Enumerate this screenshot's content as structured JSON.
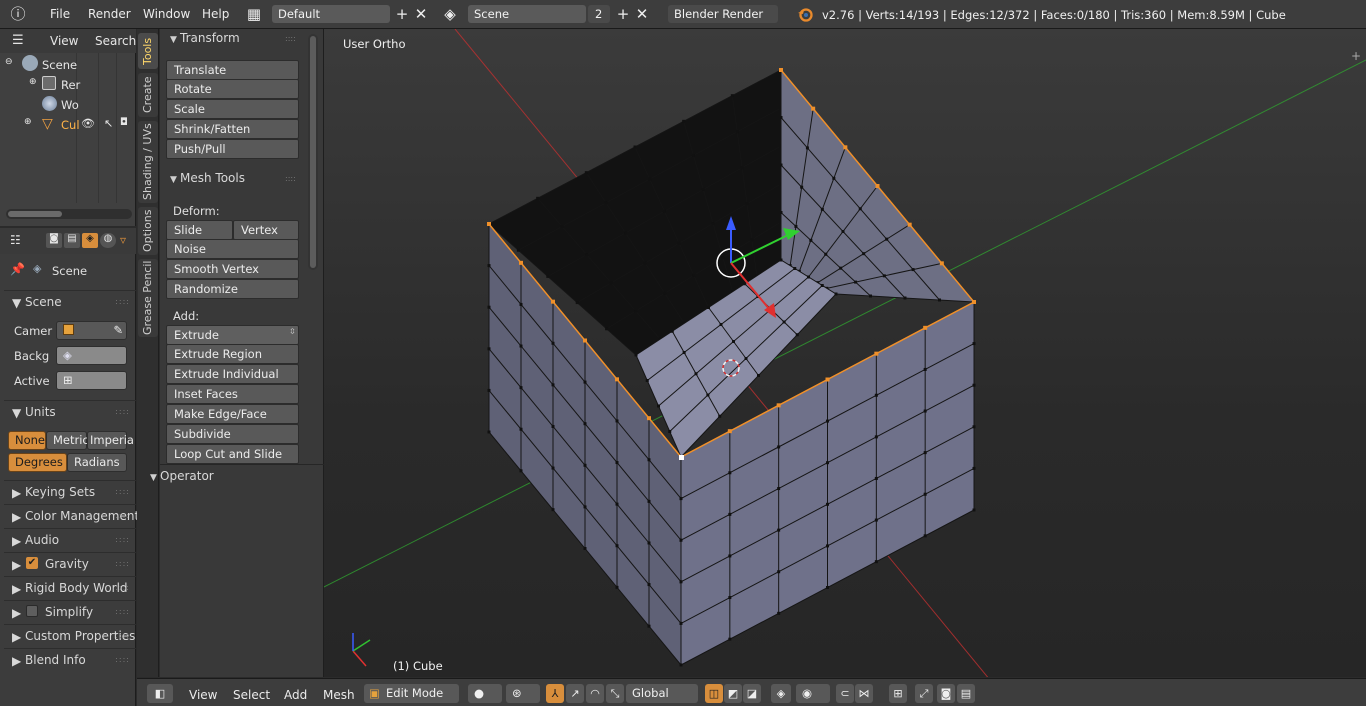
{
  "colors": {
    "accent": "#d88e3c",
    "axis_x": "#c03030",
    "axis_y": "#30a030",
    "select": "#f0902a"
  },
  "topbar": {
    "menus": [
      "File",
      "Render",
      "Window",
      "Help"
    ],
    "screen_layout": "Default",
    "scene_field": "Scene",
    "scene_users": "2",
    "render_engine": "Blender Render",
    "stats": "v2.76 | Verts:14/193 | Edges:12/372 | Faces:0/180 | Tris:360 | Mem:8.59M | Cube"
  },
  "outliner": {
    "header": {
      "view": "View",
      "search": "Search"
    },
    "items": [
      {
        "label": "Scene",
        "icon": "scene-icon"
      },
      {
        "label": "Rer",
        "icon": "render-layers-icon"
      },
      {
        "label": "Wo",
        "icon": "world-icon"
      },
      {
        "label": "Cul",
        "icon": "mesh-object-icon"
      }
    ]
  },
  "properties": {
    "context": "Scene",
    "sections": {
      "scene": "Scene",
      "camera_label": "Camer",
      "background_label": "Backg",
      "active_label": "Active",
      "units": "Units",
      "unit_none": "None",
      "unit_metric": "Metric",
      "unit_imperial": "Imperia",
      "deg": "Degrees",
      "rad": "Radians",
      "keying_sets": "Keying Sets",
      "color_management": "Color Management",
      "audio": "Audio",
      "gravity": "Gravity",
      "rigid_body": "Rigid Body World",
      "simplify": "Simplify",
      "custom_props": "Custom Properties",
      "blend_info": "Blend Info"
    }
  },
  "tooltabs": [
    "Tools",
    "Create",
    "Shading / UVs",
    "Options",
    "Grease Pencil"
  ],
  "toolshelf": {
    "transform": "Transform",
    "transform_buttons": [
      "Translate",
      "Rotate",
      "Scale",
      "Shrink/Fatten",
      "Push/Pull"
    ],
    "mesh_tools": "Mesh Tools",
    "deform": "Deform:",
    "slide_edge": "Slide Edge",
    "vertex": "Vertex",
    "deform_buttons": [
      "Noise",
      "Smooth Vertex",
      "Randomize"
    ],
    "add": "Add:",
    "extrude": "Extrude",
    "add_buttons": [
      "Extrude Region",
      "Extrude Individual",
      "Inset Faces",
      "Make Edge/Face",
      "Subdivide",
      "Loop Cut and Slide"
    ],
    "operator": "Operator"
  },
  "viewport": {
    "view_name": "User Ortho",
    "object_label": "(1) Cube"
  },
  "bottombar": {
    "menus": [
      "View",
      "Select",
      "Add",
      "Mesh"
    ],
    "mode": "Edit Mode",
    "orientation": "Global"
  }
}
